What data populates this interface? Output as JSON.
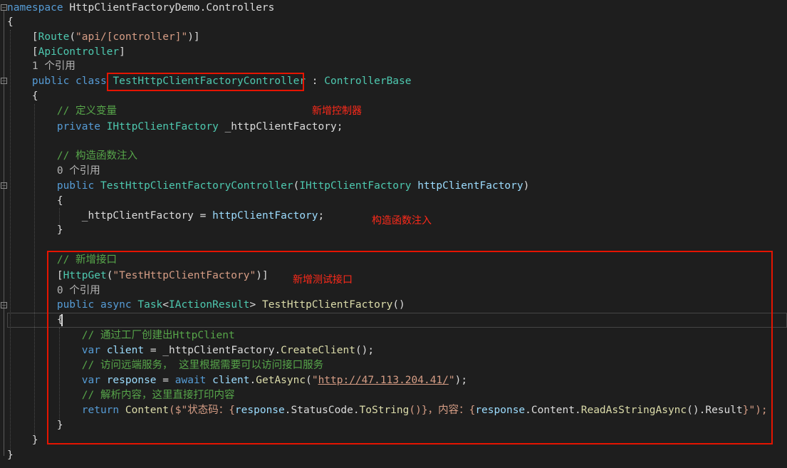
{
  "code": {
    "namespace_kw": "namespace",
    "namespace_name": "HttpClientFactoryDemo.Controllers",
    "brace_open": "{",
    "brace_close": "}",
    "attr_open": "[",
    "attr_close": "]",
    "route_attr": "Route",
    "route_paren_open": "(",
    "route_value": "\"api/[controller]\"",
    "route_paren_close": ")",
    "api_controller_attr": "ApiController",
    "refs_1": "1 个引用",
    "refs_0": "0 个引用",
    "public_kw": "public",
    "class_kw": "class",
    "class_name": "TestHttpClientFactoryController",
    "colon": " : ",
    "base_class": "ControllerBase",
    "comment_define_var": "// 定义变量",
    "private_kw": "private",
    "field_type": "IHttpClientFactory",
    "field_name": "_httpClientFactory",
    "semicolon": ";",
    "comment_ctor_inject": "// 构造函数注入",
    "ctor_name": "TestHttpClientFactoryController",
    "paren_open": "(",
    "paren_close": ")",
    "param_type": "IHttpClientFactory",
    "param_name": "httpClientFactory",
    "assign": " = ",
    "comment_new_api": "// 新增接口",
    "httpget_attr": "HttpGet",
    "httpget_value": "\"TestHttpClientFactory\"",
    "async_kw": "async",
    "task_type": "Task",
    "lt": "<",
    "gt": ">",
    "iaction_type": "IActionResult",
    "method_name": "TestHttpClientFactory",
    "empty_parens": "()",
    "comment_create_client": "// 通过工厂创建出HttpClient",
    "var_kw": "var",
    "client_var": "client",
    "dot": ".",
    "create_client": "CreateClient",
    "comment_remote": "// 访问远端服务， 这里根据需要可以访问接口服务",
    "response_var": "response",
    "await_kw": "await",
    "get_async": "GetAsync",
    "quote": "\"",
    "url": "http://47.113.204.41/",
    "comment_parse": "// 解析内容，这里直接打印内容",
    "return_kw": "return",
    "content_fn": "Content",
    "interp_start": "($\"状态码：{",
    "status_code": "StatusCode",
    "to_string": "ToString",
    "interp_mid": "()}，内容：{",
    "content_prop": "Content",
    "read_as_string": "ReadAsStringAsync",
    "result_prop": "Result",
    "interp_end": "}\");"
  },
  "annotations": {
    "new_controller": "新增控制器",
    "ctor_injection": "构造函数注入",
    "new_test_api": "新增测试接口"
  },
  "colors": {
    "background": "#1e1e1e",
    "keyword": "#569cd6",
    "type": "#4ec9b0",
    "string": "#d69d85",
    "comment": "#57a64a",
    "identifier": "#9cdcfe",
    "method": "#dcdcaa",
    "highlight_box": "#e51400",
    "annotation_text": "#ff2a1a"
  }
}
